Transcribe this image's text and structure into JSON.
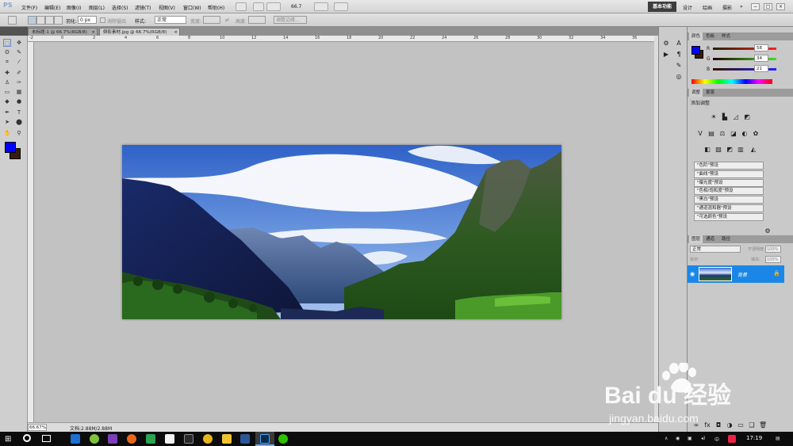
{
  "app": {
    "logo": "PS"
  },
  "menu": [
    "文件(F)",
    "编辑(E)",
    "图像(I)",
    "图层(L)",
    "选择(S)",
    "滤镜(T)",
    "视图(V)",
    "窗口(W)",
    "帮助(H)"
  ],
  "zoom_control": "66.7",
  "workspaces": {
    "active": "基本功能",
    "items": [
      "设计",
      "绘画",
      "摄影"
    ],
    "more": "»"
  },
  "window_controls": [
    "−",
    "□",
    "×"
  ],
  "options": {
    "feather_label": "羽化:",
    "feather_value": "0 px",
    "antialias_label": "消除锯齿",
    "style_label": "样式:",
    "style_value": "正常",
    "width_label": "宽度:",
    "height_label": "高度:",
    "refine_edge": "调整边缘..."
  },
  "doc_tabs": [
    {
      "label": "未标题-1 @ 66.7%(RGB/8)",
      "close": "×",
      "active": false
    },
    {
      "label": "倒影素材.jpg @ 66.7%(RGB/8)",
      "close": "×",
      "active": true
    }
  ],
  "ruler_top": [
    "-2",
    "0",
    "2",
    "4",
    "6",
    "8",
    "10",
    "12",
    "14",
    "16",
    "18",
    "20",
    "22",
    "24",
    "26",
    "28",
    "30",
    "32",
    "34",
    "36"
  ],
  "status": {
    "zoom": "66.67%",
    "doc": "文档:2.88M/2.88M"
  },
  "colors": {
    "foreground": "#0000ff",
    "background": "#3a1a0e",
    "accent": "#1a87e8"
  },
  "color_panel": {
    "tabs": [
      "颜色",
      "色板",
      "样式"
    ],
    "channels": [
      {
        "label": "R",
        "value": "58"
      },
      {
        "label": "G",
        "value": "34"
      },
      {
        "label": "B",
        "value": "21"
      }
    ]
  },
  "adjustments_panel": {
    "tabs": [
      "调整",
      "蒙版"
    ],
    "title": "添加调整",
    "presets": [
      "\"色阶\"预设",
      "\"曲线\"预设",
      "\"曝光度\"预设",
      "\"色相/饱和度\"预设",
      "\"黑白\"预设",
      "\"通道混和器\"预设",
      "\"可选颜色\"预设"
    ]
  },
  "layers_panel": {
    "tabs": [
      "图层",
      "通道",
      "路径"
    ],
    "blend_mode": "正常",
    "opacity_label": "不透明度:",
    "opacity_value": "100%",
    "lock_label": "锁定:",
    "fill_label": "填充:",
    "fill_value": "100%",
    "layer_name": "背景"
  },
  "taskbar": {
    "time": "17:19",
    "ime": "中"
  },
  "watermark": {
    "brand": "Bai du 经验",
    "url": "jingyan.baidu.com"
  }
}
